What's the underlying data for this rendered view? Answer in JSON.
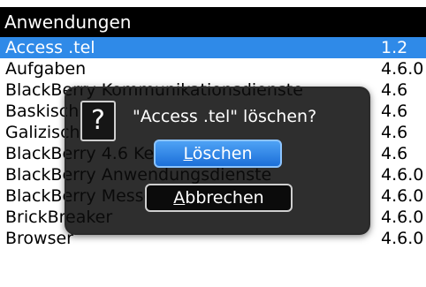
{
  "header": {
    "title": "Anwendungen"
  },
  "list": {
    "rows": [
      {
        "name": "Access .tel",
        "version": "1.2",
        "selected": true
      },
      {
        "name": "Aufgaben",
        "version": "4.6.0",
        "selected": false
      },
      {
        "name": "BlackBerry Kommunikationsdienste",
        "version": "4.6",
        "selected": false
      },
      {
        "name": "Baskisch",
        "version": "4.6",
        "selected": false
      },
      {
        "name": "Galizisch",
        "version": "4.6",
        "selected": false
      },
      {
        "name": "BlackBerry 4.6 Kernsoftware",
        "version": "4.6",
        "selected": false
      },
      {
        "name": "BlackBerry Anwendungsdienste",
        "version": "4.6.0",
        "selected": false
      },
      {
        "name": "BlackBerry Messenger",
        "version": "4.6.0",
        "selected": false
      },
      {
        "name": "BrickBreaker",
        "version": "4.6.0",
        "selected": false
      },
      {
        "name": "Browser",
        "version": "4.6.0",
        "selected": false
      }
    ]
  },
  "dialog": {
    "icon": "question-icon",
    "icon_glyph": "?",
    "message": "\"Access .tel\" löschen?",
    "primary": {
      "accel": "L",
      "rest": "öschen"
    },
    "secondary": {
      "accel": "A",
      "rest": "bbrechen"
    }
  },
  "colors": {
    "header_bg": "#000000",
    "selection": "#2f8ae8",
    "dialog_bg": "#111111"
  }
}
